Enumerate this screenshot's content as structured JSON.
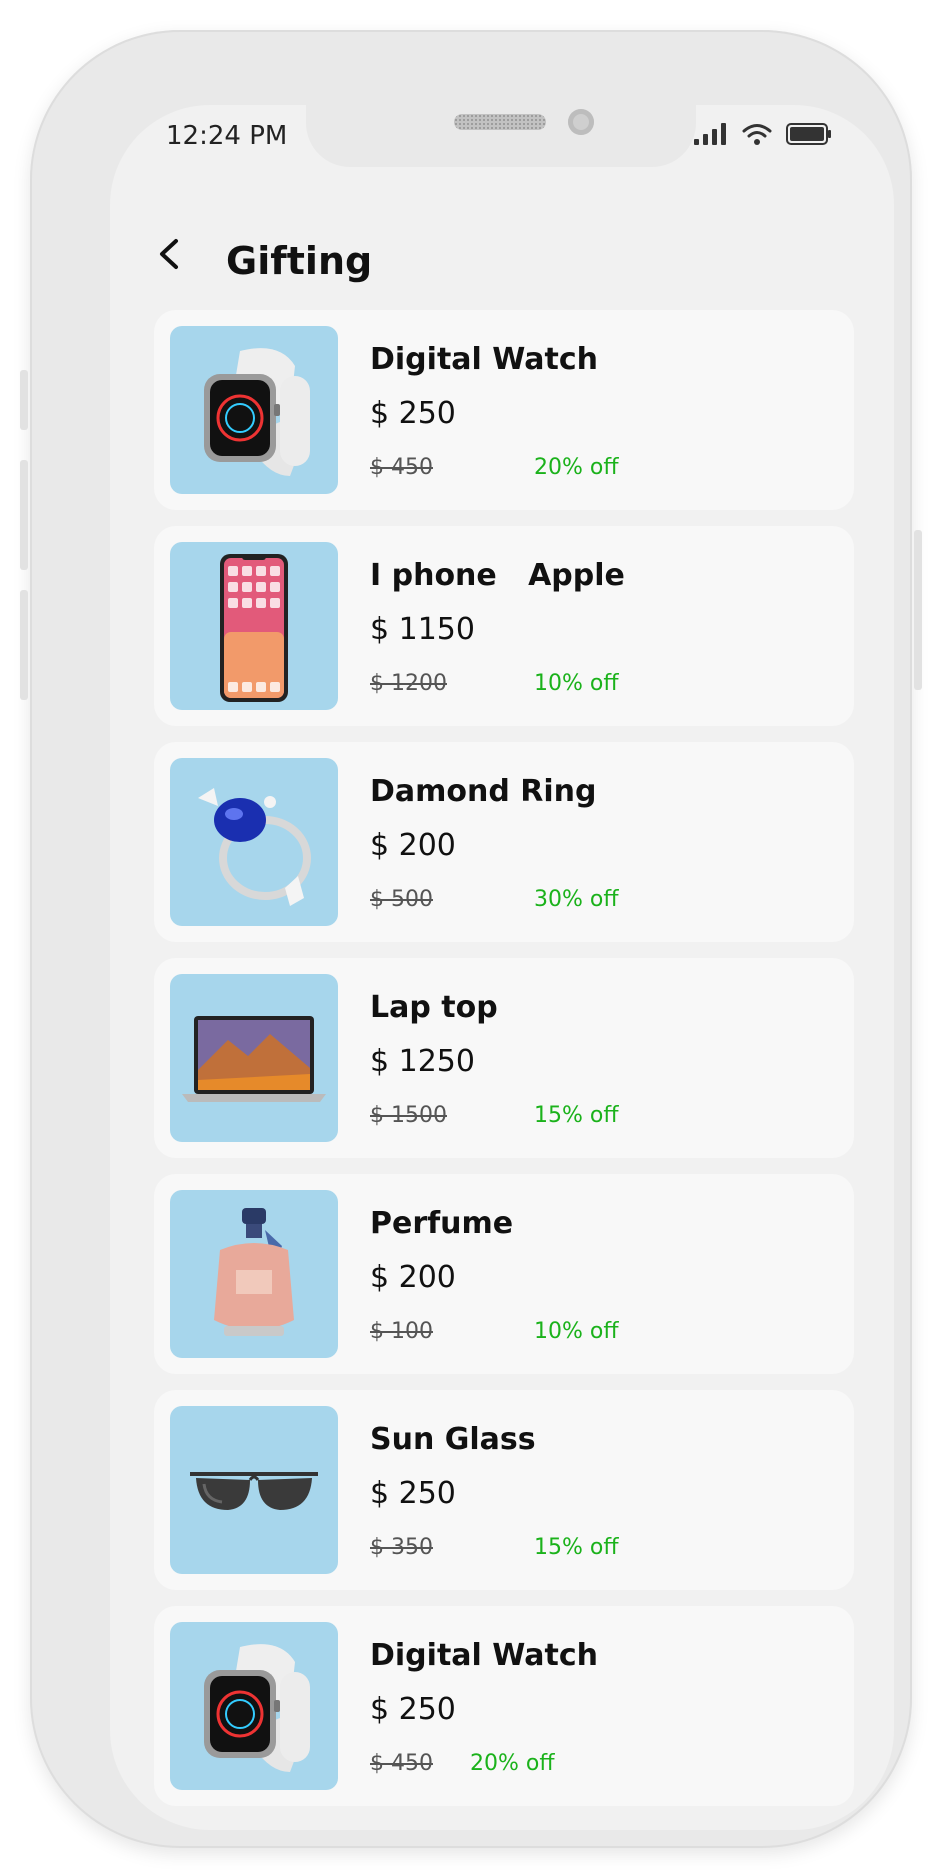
{
  "status_bar": {
    "time": "12:24 PM",
    "icons": [
      "signal-icon",
      "wifi-icon",
      "battery-icon"
    ]
  },
  "header": {
    "back_icon": "chevron-left-icon",
    "title": "Gifting"
  },
  "colors": {
    "thumb_bg": "#a7d6ec",
    "discount": "#1bb21b",
    "card_bg": "#f8f8f8",
    "screen_bg": "#f1f1f1"
  },
  "products": [
    {
      "name": "Digital Watch",
      "price": "$ 250",
      "old_price": "$ 450",
      "discount": "20% off",
      "image": "watch"
    },
    {
      "name": "I phone   Apple",
      "price": "$ 1150",
      "old_price": "$ 1200",
      "discount": "10% off",
      "image": "phone"
    },
    {
      "name": "Damond Ring",
      "price": "$ 200",
      "old_price": "$ 500",
      "discount": "30% off",
      "image": "ring"
    },
    {
      "name": "Lap top",
      "price": "$ 1250",
      "old_price": "$ 1500",
      "discount": "15% off",
      "image": "laptop"
    },
    {
      "name": "Perfume",
      "price": "$ 200",
      "old_price": "$ 100",
      "discount": "10% off",
      "image": "perfume"
    },
    {
      "name": "Sun Glass",
      "price": "$ 250",
      "old_price": "$ 350",
      "discount": "15% off",
      "image": "sunglasses"
    },
    {
      "name": "Digital Watch",
      "price": "$ 250",
      "old_price": "$ 450",
      "discount": "20% off",
      "image": "watch"
    }
  ]
}
